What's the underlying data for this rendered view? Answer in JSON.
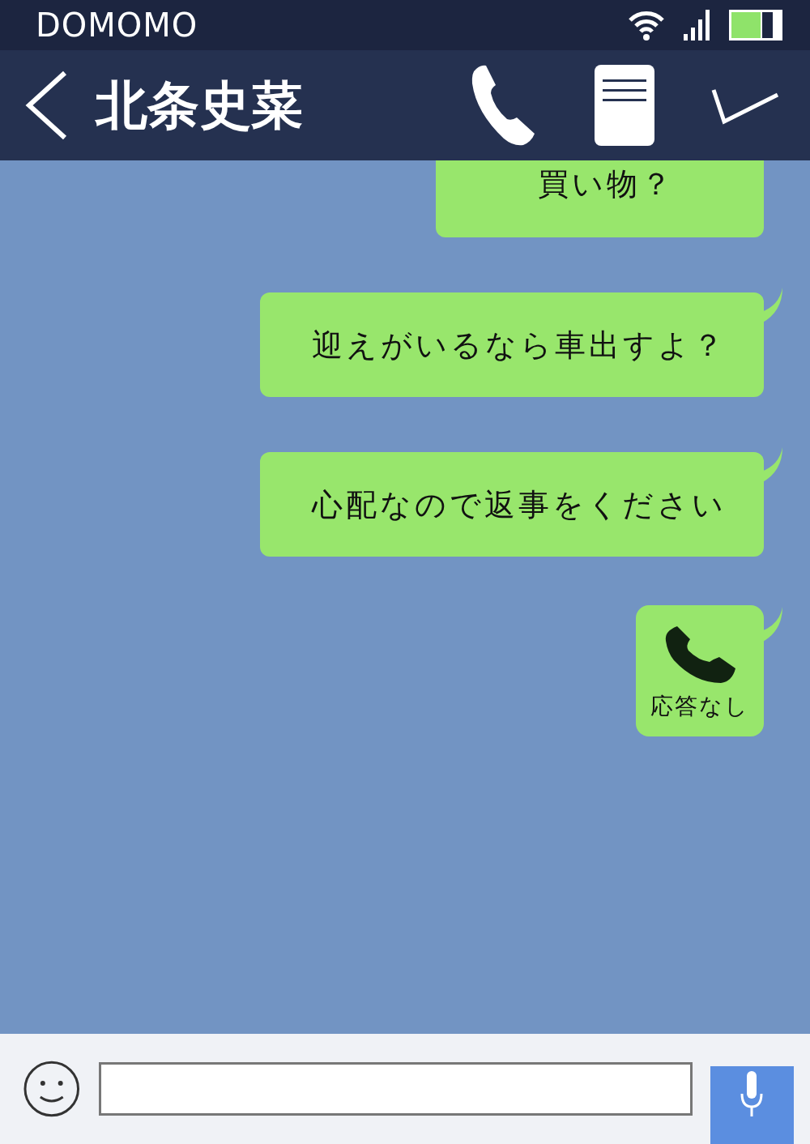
{
  "status_bar": {
    "carrier": "DOMOMO"
  },
  "header": {
    "title": "北条史菜"
  },
  "messages": [
    {
      "kind": "text",
      "text": "買い物？"
    },
    {
      "kind": "text",
      "text": "迎えがいるなら車出すよ？"
    },
    {
      "kind": "text",
      "text": "心配なので返事をください"
    },
    {
      "kind": "call",
      "text": "応答なし"
    }
  ]
}
